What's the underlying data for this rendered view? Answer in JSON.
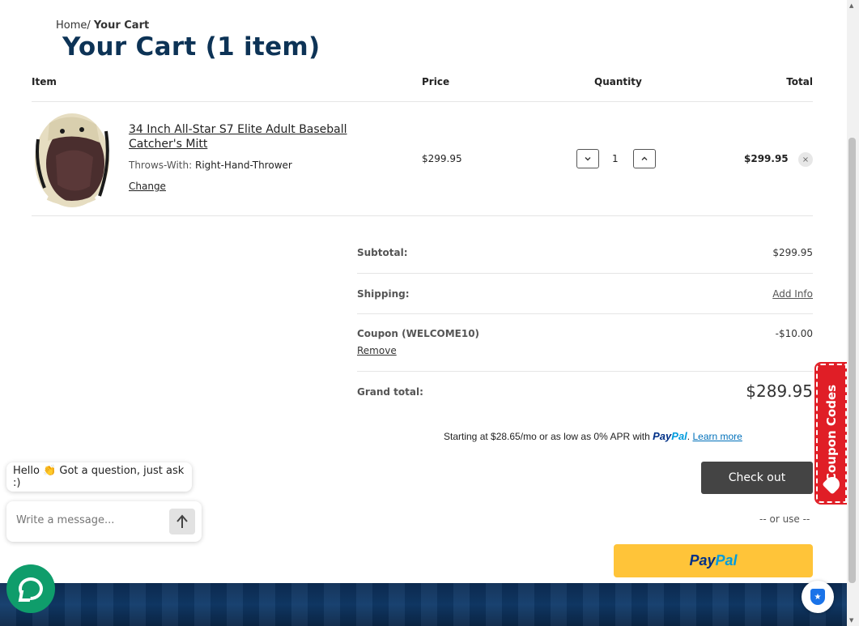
{
  "breadcrumb": {
    "home": "Home",
    "separator": "/",
    "current": "Your Cart"
  },
  "page_title": "Your Cart (1 item)",
  "table_header": {
    "item": "Item",
    "price": "Price",
    "quantity": "Quantity",
    "total": "Total"
  },
  "cart_items": [
    {
      "name": "34 Inch All-Star S7 Elite Adult Baseball Catcher's Mitt",
      "option_label": "Throws-With:",
      "option_value": "Right-Hand-Thrower",
      "change_label": "Change",
      "price": "$299.95",
      "quantity": "1",
      "total": "$299.95",
      "remove_icon": "×"
    }
  ],
  "totals": {
    "subtotal_label": "Subtotal:",
    "subtotal_value": "$299.95",
    "shipping_label": "Shipping:",
    "shipping_value": "Add Info",
    "coupon_label": "Coupon (WELCOME10)",
    "coupon_value": "-$10.00",
    "coupon_remove": "Remove",
    "grand_label": "Grand total:",
    "grand_value": "$289.95"
  },
  "paypal_message": {
    "text": "Starting at $28.65/mo or as low as 0% APR with",
    "logo_pay": "Pay",
    "logo_pal": "Pal",
    "learn_more": "Learn more"
  },
  "checkout_label": "Check out",
  "or_use_label": "-- or use --",
  "paypal_button": {
    "pay": "Pay",
    "pal": "Pal"
  },
  "coupon_tab_label": "Coupon Codes",
  "chat": {
    "greeting": "Hello 👏 Got a question, just ask :)",
    "input_placeholder": "Write a message..."
  },
  "colors": {
    "title": "#0d3356",
    "checkout_bg": "#444444",
    "paypal_yellow": "#ffc439",
    "coupon_red": "#e01e26",
    "chat_green": "#0f9d6b"
  }
}
